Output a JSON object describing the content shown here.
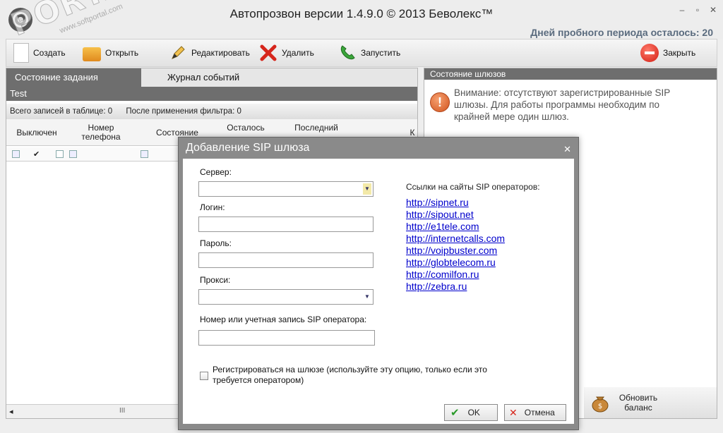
{
  "window": {
    "title": "Автопрозвон версии 1.4.9.0 © 2013 Беволекс™",
    "trial": "Дней пробного периода осталось: 20",
    "min": "–",
    "max": "▫",
    "close": "✕"
  },
  "watermark": {
    "big": "PORTAL",
    "small": "www.softportal.com"
  },
  "toolbar": {
    "create": "Создать",
    "open": "Открыть",
    "edit": "Редактировать",
    "delete": "Удалить",
    "start": "Запустить",
    "close": "Закрыть"
  },
  "tabs": {
    "state": "Состояние задания",
    "log": "Журнал событий"
  },
  "task": {
    "name": "Test",
    "records_total": "Всего записей в таблице: 0",
    "records_filtered": "После применения фильтра: 0",
    "columns": [
      "Выключен",
      "Номер телефона",
      "Состояние",
      "Осталось",
      "Последний",
      "К"
    ],
    "scroll_grip": "III",
    "scroll_left": "◂"
  },
  "gateways": {
    "header": "Состояние шлюзов",
    "warning": "Внимание: отсутствуют зарегистрированные SIP шлюзы. Для работы программы необходим по крайней мере один шлюз.",
    "balance": "Обновить баланс"
  },
  "dialog": {
    "title": "Добавление SIP шлюза",
    "close": "✕",
    "server_label": "Сервер:",
    "login_label": "Логин:",
    "password_label": "Пароль:",
    "proxy_label": "Прокси:",
    "account_label": "Номер или учетная запись SIP оператора:",
    "links_title": "Ссылки на сайты SIP операторов:",
    "links": [
      "http://sipnet.ru",
      "http://sipout.net",
      "http://e1tele.com",
      "http://internetcalls.com",
      "http://voipbuster.com",
      "http://globtelecom.ru",
      "http://comilfon.ru",
      "http://zebra.ru"
    ],
    "register_label": "Регистрироваться на шлюзе (используйте эту опцию, только если это требуется оператором)",
    "ok": "OK",
    "cancel": "Отмена"
  }
}
